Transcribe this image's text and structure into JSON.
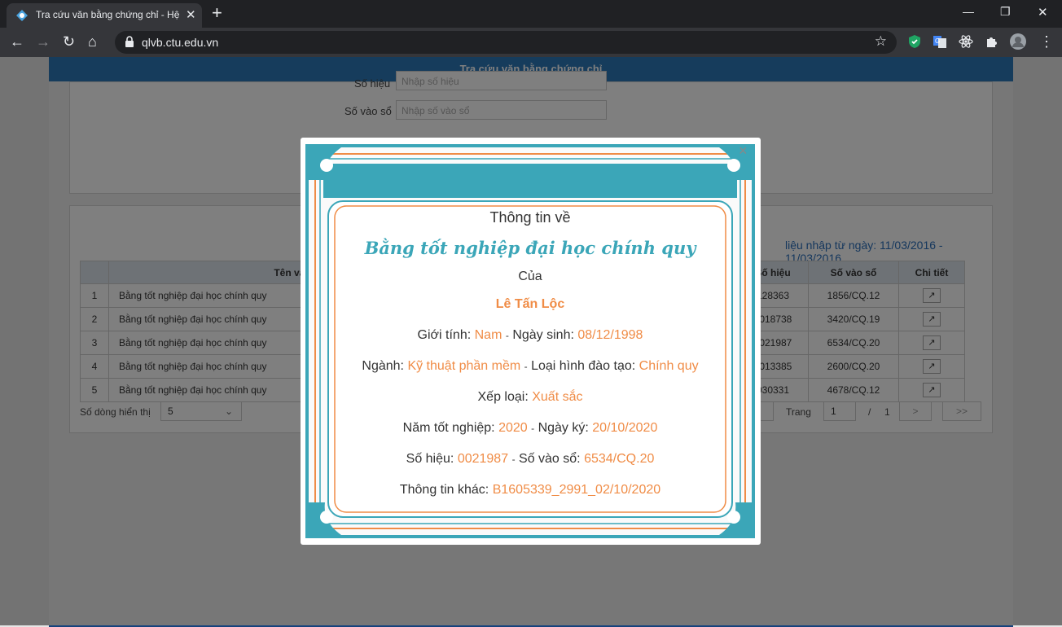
{
  "browser": {
    "tab_title": "Tra cứu văn bằng chứng chỉ - Hệ",
    "url": "qlvb.ctu.edu.vn"
  },
  "page": {
    "banner_title": "Tra cứu văn bằng chứng chỉ",
    "form": {
      "so_hieu_label": "Số hiệu",
      "so_hieu_placeholder": "Nhập số hiệu",
      "so_vao_so_label": "Số vào sổ",
      "so_vao_so_placeholder": "Nhập số vào sổ"
    },
    "results": {
      "date_range_text": "liệu nhập từ ngày: 11/03/2016 - 11/03/2016",
      "headers": [
        "",
        "Tên văn bằng",
        "Số hiệu",
        "Số vào sổ",
        "Chi tiết"
      ],
      "rows": [
        {
          "stt": "1",
          "ten": "Bằng tốt nghiệp đại học chính quy",
          "so_hieu": "128363",
          "so_vao_so": "1856/CQ.12"
        },
        {
          "stt": "2",
          "ten": "Bằng tốt nghiệp đại học chính quy",
          "so_hieu": "0018738",
          "so_vao_so": "3420/CQ.19"
        },
        {
          "stt": "3",
          "ten": "Bằng tốt nghiệp đại học chính quy",
          "so_hieu": "0021987",
          "so_vao_so": "6534/CQ.20"
        },
        {
          "stt": "4",
          "ten": "Bằng tốt nghiệp đại học chính quy",
          "so_hieu": "0013385",
          "so_vao_so": "2600/CQ.20"
        },
        {
          "stt": "5",
          "ten": "Bằng tốt nghiệp đại học chính quy",
          "so_hieu": "030331",
          "so_vao_so": "4678/CQ.12"
        }
      ]
    },
    "pagination": {
      "rows_label": "Số dòng hiển thị",
      "rows_value": "5",
      "page_label": "Trang",
      "page_value": "1",
      "page_sep": "/",
      "page_total": "1",
      "next": ">",
      "last": ">>"
    }
  },
  "modal": {
    "close": "×",
    "heading": "Thông tin về",
    "title": "Bằng tốt nghiệp đại học chính quy",
    "of_label": "Của",
    "name": "Lê Tấn Lộc",
    "gender_label": "Giới tính:",
    "gender": "Nam",
    "dob_label": "Ngày sinh:",
    "dob": "08/12/1998",
    "major_label": "Ngành:",
    "major": "Kỹ thuật phần mềm",
    "training_label": "Loại hình đào tạo:",
    "training": "Chính quy",
    "rank_label": "Xếp loại:",
    "rank": "Xuất sắc",
    "grad_year_label": "Năm tốt nghiệp:",
    "grad_year": "2020",
    "sign_date_label": "Ngày ký:",
    "sign_date": "20/10/2020",
    "serial_label": "Số hiệu:",
    "serial": "0021987",
    "reg_label": "Số vào sổ:",
    "reg": "6534/CQ.20",
    "other_label": "Thông tin khác:",
    "other": "B1605339_2991_02/10/2020",
    "separator": "-"
  },
  "colors": {
    "accent_teal": "#3ba6b8",
    "accent_orange": "#f08c46",
    "banner_blue": "#2d78b8"
  }
}
